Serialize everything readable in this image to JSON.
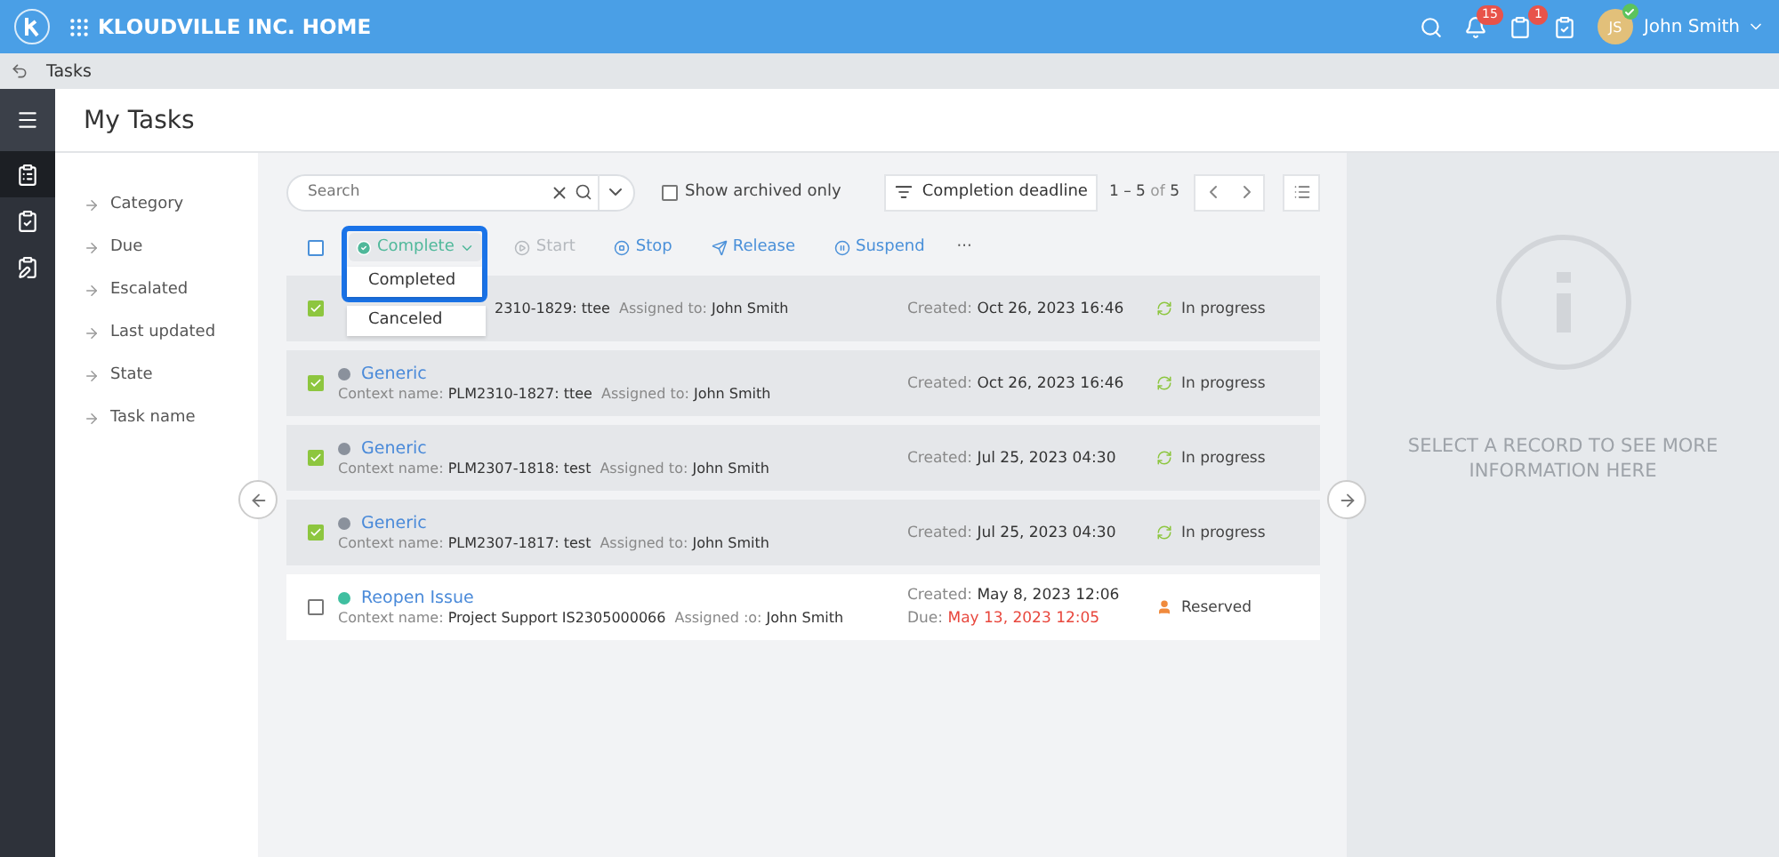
{
  "header": {
    "title": "KLOUDVILLE INC. HOME",
    "notifications_badge": "15",
    "timers_badge": "1",
    "user": {
      "initials": "JS",
      "name": "John Smith",
      "online": true
    }
  },
  "breadcrumb": "Tasks",
  "rail": [
    {
      "kind": "menu",
      "selected": false
    },
    {
      "kind": "timer",
      "selected": true
    },
    {
      "kind": "check",
      "selected": false
    },
    {
      "kind": "person",
      "selected": false
    }
  ],
  "page_title": "My Tasks",
  "filters": [
    "Category",
    "Due",
    "Escalated",
    "Last updated",
    "State",
    "Task name"
  ],
  "search": {
    "placeholder": "Search"
  },
  "archived": {
    "label": "Show archived only",
    "checked": false
  },
  "sort": "Completion deadline",
  "pager": {
    "range": "1 – 5",
    "of": "of",
    "total": "5"
  },
  "select_all": {
    "checked": false
  },
  "actions": [
    {
      "kind": "complete",
      "label": "Complete",
      "disabled": false
    },
    {
      "kind": "start",
      "label": "Start",
      "disabled": true
    },
    {
      "kind": "stop",
      "label": "Stop",
      "disabled": false
    },
    {
      "kind": "release",
      "label": "Release",
      "disabled": false
    },
    {
      "kind": "suspend",
      "label": "Suspend",
      "disabled": false
    }
  ],
  "more": "···",
  "complete_menu": {
    "highlighted": true,
    "options": [
      "Completed",
      "Canceled"
    ]
  },
  "rows": [
    {
      "checked": true,
      "context": "2310-1829: ttee",
      "assigned_label": "Assigned to:",
      "assignee": "John Smith",
      "created_label": "Created:",
      "created": "Oct 26, 2023 16:46",
      "status": {
        "kind": "progress",
        "label": "In progress"
      }
    },
    {
      "checked": true,
      "title": "Generic",
      "color": "#8a919c",
      "context_label": "Context name:",
      "context": "PLM2310-1827: ttee",
      "assigned_label": "Assigned to:",
      "assignee": "John Smith",
      "created_label": "Created:",
      "created": "Oct 26, 2023 16:46",
      "status": {
        "kind": "progress",
        "label": "In progress"
      }
    },
    {
      "checked": true,
      "title": "Generic",
      "color": "#8a919c",
      "context_label": "Context name:",
      "context": "PLM2307-1818: test",
      "assigned_label": "Assigned to:",
      "assignee": "John Smith",
      "created_label": "Created:",
      "created": "Jul 25, 2023 04:30",
      "status": {
        "kind": "progress",
        "label": "In progress"
      }
    },
    {
      "checked": true,
      "title": "Generic",
      "color": "#8a919c",
      "context_label": "Context name:",
      "context": "PLM2307-1817: test",
      "assigned_label": "Assigned to:",
      "assignee": "John Smith",
      "created_label": "Created:",
      "created": "Jul 25, 2023 04:30",
      "status": {
        "kind": "progress",
        "label": "In progress"
      }
    },
    {
      "checked": false,
      "title": "Reopen Issue",
      "color": "#3fbfa0",
      "context_label": "Context name:",
      "context": "Project Support IS2305000066",
      "assigned_label": "Assigned :o:",
      "assignee": "John Smith",
      "created_label": "Created:",
      "created": "May 8, 2023 12:06",
      "due_label": "Due:",
      "due": "May 13, 2023 12:05",
      "status": {
        "kind": "reserved",
        "label": "Reserved"
      }
    }
  ],
  "detail": {
    "message": "SELECT A RECORD TO SEE MORE INFORMATION HERE"
  }
}
